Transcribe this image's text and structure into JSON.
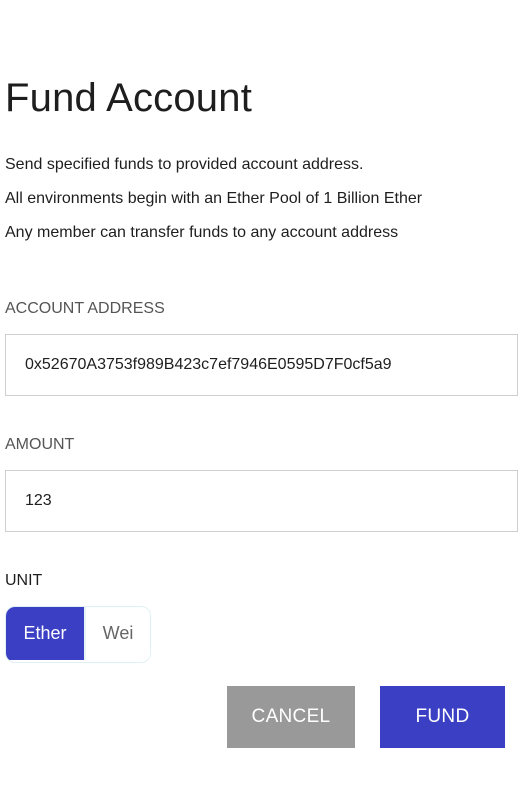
{
  "header": {
    "title": "Fund Account"
  },
  "description": {
    "line1": "Send specified funds to provided account address.",
    "line2": "All environments begin with an Ether Pool of 1 Billion Ether",
    "line3": "Any member can transfer funds to any account address"
  },
  "form": {
    "account_address": {
      "label": "ACCOUNT ADDRESS",
      "value": "0x52670A3753f989B423c7ef7946E0595D7F0cf5a9"
    },
    "amount": {
      "label": "AMOUNT",
      "value": "123"
    },
    "unit": {
      "label": "UNIT",
      "options": [
        "Ether",
        "Wei"
      ],
      "selected": "Ether"
    }
  },
  "actions": {
    "cancel_label": "CANCEL",
    "fund_label": "FUND"
  },
  "colors": {
    "accent": "#3a3fc4",
    "cancel": "#999999"
  }
}
